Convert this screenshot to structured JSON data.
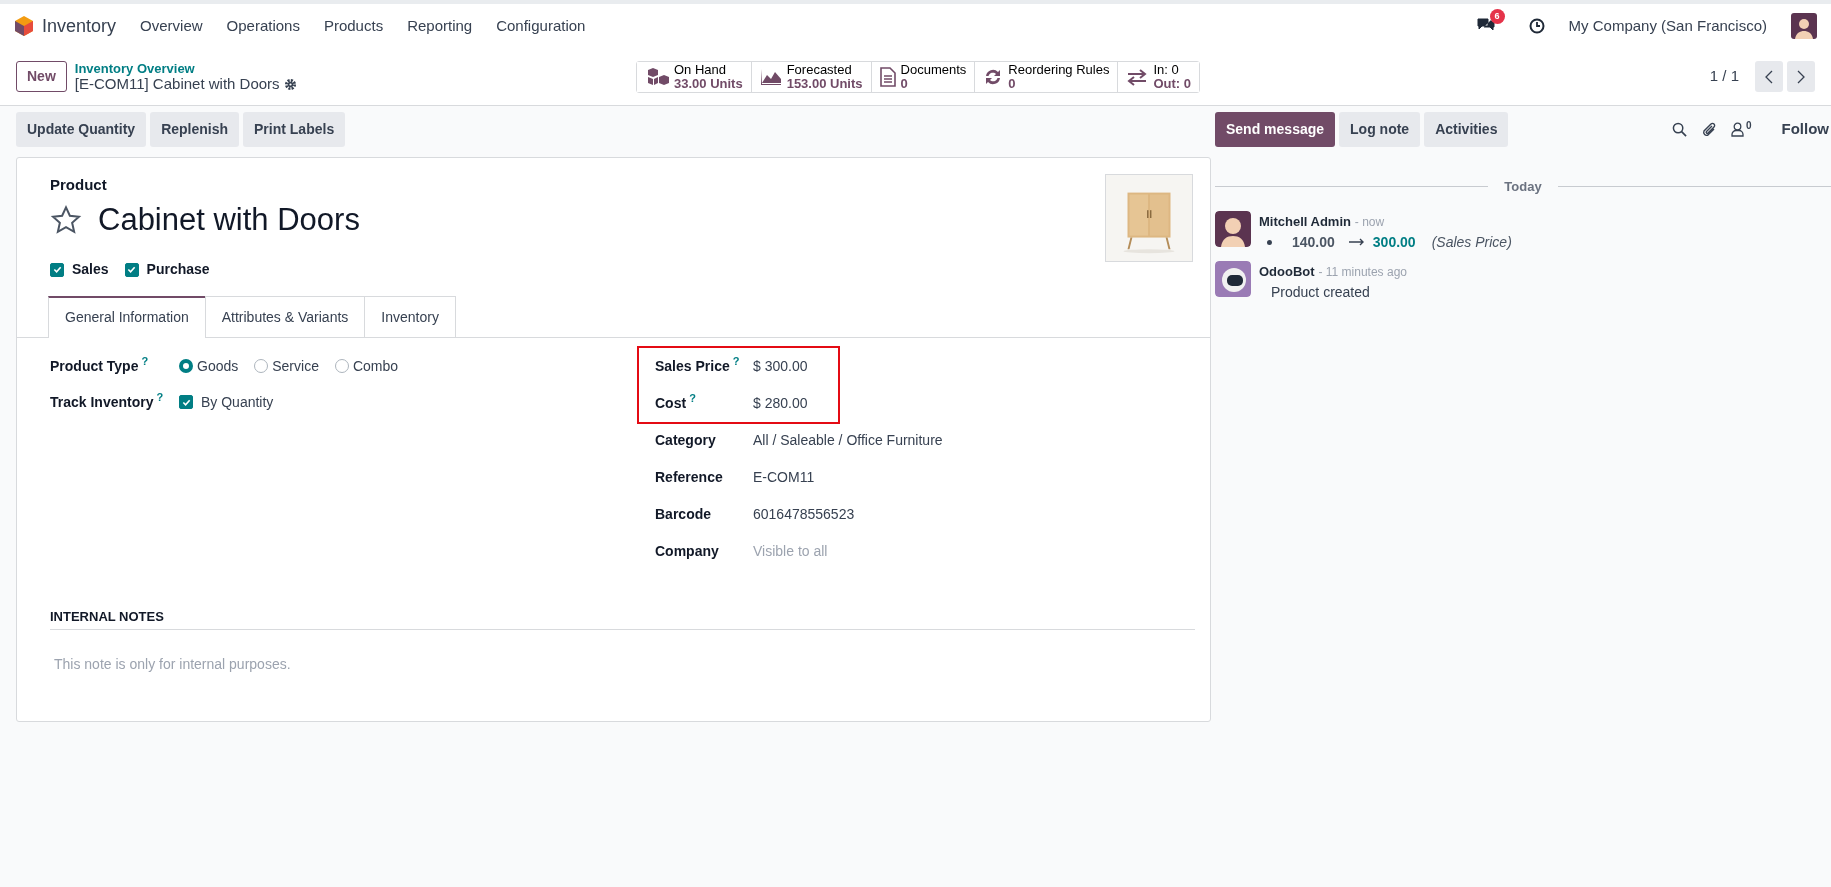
{
  "navbar": {
    "app": "Inventory",
    "menus": [
      "Overview",
      "Operations",
      "Products",
      "Reporting",
      "Configuration"
    ],
    "message_count": "6",
    "company": "My Company (San Francisco)"
  },
  "control_panel": {
    "new_button": "New",
    "breadcrumb": "Inventory Overview",
    "record_title": "[E-COM11] Cabinet with Doors",
    "pager": "1 / 1",
    "stat_buttons": [
      {
        "kind": "boxes",
        "label": "On Hand",
        "value": "33.00 Units"
      },
      {
        "kind": "chart",
        "label": "Forecasted",
        "value": "153.00 Units"
      },
      {
        "kind": "document",
        "label": "Documents",
        "value": "0"
      },
      {
        "kind": "refresh",
        "label": "Reordering Rules",
        "value": "0"
      },
      {
        "kind": "transfer",
        "label": "In: 0",
        "value": "Out: 0"
      }
    ]
  },
  "action_buttons": [
    "Update Quantity",
    "Replenish",
    "Print Labels"
  ],
  "form": {
    "label": "Product",
    "name": "Cabinet with Doors",
    "favorite": false,
    "options": [
      {
        "label": "Sales",
        "checked": true
      },
      {
        "label": "Purchase",
        "checked": true
      }
    ],
    "tabs": [
      {
        "label": "General Information",
        "selected": true
      },
      {
        "label": "Attributes & Variants",
        "selected": false
      },
      {
        "label": "Inventory",
        "selected": false
      }
    ],
    "left_fields": [
      {
        "kind": "radio",
        "label": "Product Type",
        "help": "?",
        "options": [
          {
            "label": "Goods",
            "selected": true
          },
          {
            "label": "Service",
            "selected": false
          },
          {
            "label": "Combo",
            "selected": false
          }
        ]
      },
      {
        "kind": "checkbox",
        "label": "Track Inventory",
        "help": "?",
        "checked": true,
        "value": "By Quantity"
      }
    ],
    "price_fields": {
      "highlighted": true,
      "fields": [
        {
          "label": "Sales Price",
          "help": "?",
          "value": "$ 300.00"
        },
        {
          "label": "Cost",
          "help": "?",
          "value": "$ 280.00"
        }
      ]
    },
    "right_fields": [
      {
        "label": "Category",
        "value": "All / Saleable / Office Furniture"
      },
      {
        "label": "Reference",
        "value": "E-COM11"
      },
      {
        "label": "Barcode",
        "value": "6016478556523"
      },
      {
        "label": "Company",
        "placeholder": "Visible to all"
      }
    ],
    "notes": {
      "title": "INTERNAL NOTES",
      "placeholder": "This note is only for internal purposes."
    }
  },
  "chatter": {
    "buttons": [
      {
        "label": "Send message",
        "primary": true
      },
      {
        "label": "Log note",
        "primary": false
      },
      {
        "label": "Activities",
        "primary": false
      }
    ],
    "follower_count": "0",
    "follow": "Follow",
    "date_separator": "Today",
    "messages": [
      {
        "author": "Mitchell Admin",
        "time": "- now",
        "kind": "change",
        "old": "140.00",
        "new": "300.00",
        "field": "(Sales Price)"
      },
      {
        "author": "OdooBot",
        "time": "- 11 minutes ago",
        "kind": "text",
        "body": "Product created"
      }
    ]
  }
}
